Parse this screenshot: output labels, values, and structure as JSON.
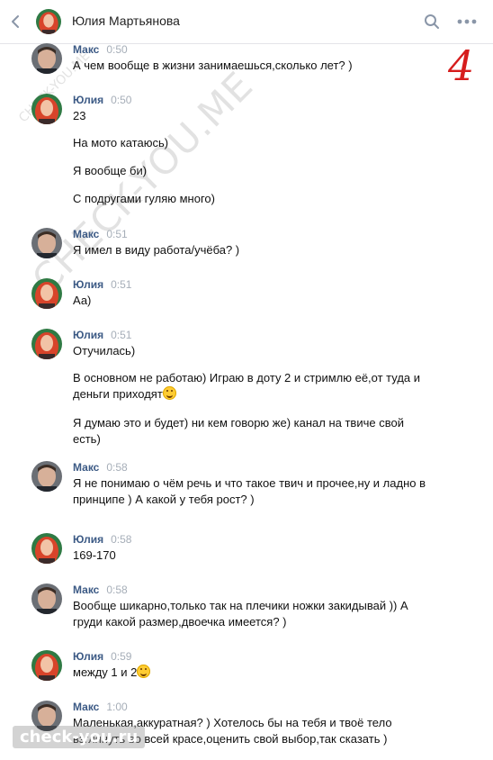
{
  "header": {
    "contact_name": "Юлия Мартьянова",
    "back_icon": "chevron-left-icon",
    "search_icon": "search-icon",
    "more_icon": "more-horizontal-icon"
  },
  "overlay": {
    "number": "4",
    "watermark_top": "CHECK-YOU.ME",
    "watermark_small": "CHECK-YOU.ME",
    "watermark_bottom": "check-you.ru"
  },
  "colors": {
    "author": "#3c5a85",
    "time": "#a6aeb8",
    "number": "#d61d1d",
    "text": "#111111"
  },
  "messages": [
    {
      "author": "Макс",
      "time": "0:50",
      "lines": [
        "А чем вообще в жизни занимаешься,сколько лет? )"
      ]
    },
    {
      "author": "Юлия",
      "time": "0:50",
      "lines": [
        "23",
        "На мото катаюсь)",
        "Я вообще би)",
        "С подругами гуляю много)"
      ]
    },
    {
      "author": "Макс",
      "time": "0:51",
      "lines": [
        "Я имел в виду работа/учёба? )"
      ]
    },
    {
      "author": "Юлия",
      "time": "0:51",
      "lines": [
        "Аа)"
      ]
    },
    {
      "author": "Юлия",
      "time": "0:51",
      "lines": [
        "Отучилась)",
        "В основном не работаю) Играю в доту 2 и стримлю её,от туда и деньги приходят",
        "Я думаю это и будет) ни кем говорю же) канал на твиче свой есть)"
      ]
    },
    {
      "author": "Макс",
      "time": "0:58",
      "lines": [
        "Я не понимаю о чём речь и что такое твич и прочее,ну и ладно в принципе ) А какой у тебя рост? )"
      ]
    },
    {
      "author": "Юлия",
      "time": "0:58",
      "lines": [
        "169-170"
      ]
    },
    {
      "author": "Макс",
      "time": "0:58",
      "lines": [
        "Вообще шикарно,только так на плечики ножки закидывай )) А груди какой размер,двоечка имеется? )"
      ]
    },
    {
      "author": "Юлия",
      "time": "0:59",
      "lines": [
        "между 1 и 2"
      ]
    },
    {
      "author": "Макс",
      "time": "1:00",
      "lines": [
        "Маленькая,аккуратная? ) Хотелось бы на тебя и твоё тело взглянуть во всей красе,оценить свой выбор,так сказать )"
      ]
    }
  ]
}
